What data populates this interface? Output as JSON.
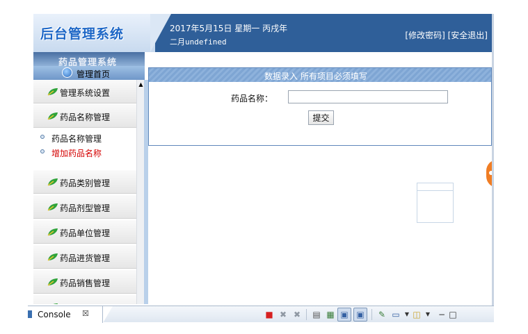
{
  "header": {
    "logo": "后台管理系统",
    "date_line1": "2017年5月15日 星期一 丙戌年",
    "date_line2": "二月undefined",
    "link_change_password": "[修改密码]",
    "link_logout": "[安全退出]"
  },
  "sidebar": {
    "system_title": "药品管理系统",
    "home_label": "管理首页",
    "menus": [
      {
        "label": "管理系统设置"
      },
      {
        "label": "药品名称管理"
      },
      {
        "label": "药品类别管理"
      },
      {
        "label": "药品剂型管理"
      },
      {
        "label": "药品单位管理"
      },
      {
        "label": "药品进货管理"
      },
      {
        "label": "药品销售管理"
      }
    ],
    "sub_items": [
      {
        "label": "药品名称管理",
        "color": "#111111"
      },
      {
        "label": "增加药品名称",
        "color": "#d40000"
      }
    ]
  },
  "form": {
    "header": "数据录入 所有项目必须填写",
    "name_label": "药品名称：",
    "name_value": "",
    "submit_label": "提交"
  },
  "console": {
    "tab_label": "Console",
    "close_glyph": "☒"
  },
  "colors": {
    "header_bg": "#2f5f99",
    "accent_red": "#d40000",
    "badge_orange": "#f07d24"
  }
}
